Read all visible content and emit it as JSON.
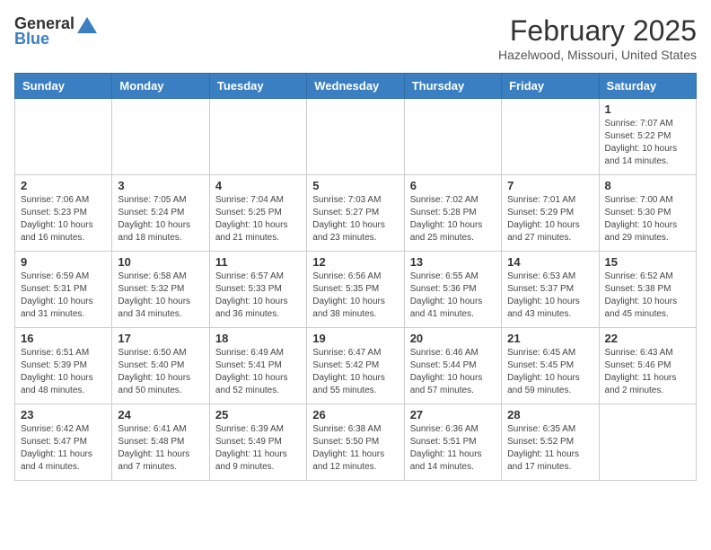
{
  "header": {
    "logo_general": "General",
    "logo_blue": "Blue",
    "month_title": "February 2025",
    "location": "Hazelwood, Missouri, United States"
  },
  "weekdays": [
    "Sunday",
    "Monday",
    "Tuesday",
    "Wednesday",
    "Thursday",
    "Friday",
    "Saturday"
  ],
  "weeks": [
    [
      {
        "day": "",
        "info": ""
      },
      {
        "day": "",
        "info": ""
      },
      {
        "day": "",
        "info": ""
      },
      {
        "day": "",
        "info": ""
      },
      {
        "day": "",
        "info": ""
      },
      {
        "day": "",
        "info": ""
      },
      {
        "day": "1",
        "info": "Sunrise: 7:07 AM\nSunset: 5:22 PM\nDaylight: 10 hours\nand 14 minutes."
      }
    ],
    [
      {
        "day": "2",
        "info": "Sunrise: 7:06 AM\nSunset: 5:23 PM\nDaylight: 10 hours\nand 16 minutes."
      },
      {
        "day": "3",
        "info": "Sunrise: 7:05 AM\nSunset: 5:24 PM\nDaylight: 10 hours\nand 18 minutes."
      },
      {
        "day": "4",
        "info": "Sunrise: 7:04 AM\nSunset: 5:25 PM\nDaylight: 10 hours\nand 21 minutes."
      },
      {
        "day": "5",
        "info": "Sunrise: 7:03 AM\nSunset: 5:27 PM\nDaylight: 10 hours\nand 23 minutes."
      },
      {
        "day": "6",
        "info": "Sunrise: 7:02 AM\nSunset: 5:28 PM\nDaylight: 10 hours\nand 25 minutes."
      },
      {
        "day": "7",
        "info": "Sunrise: 7:01 AM\nSunset: 5:29 PM\nDaylight: 10 hours\nand 27 minutes."
      },
      {
        "day": "8",
        "info": "Sunrise: 7:00 AM\nSunset: 5:30 PM\nDaylight: 10 hours\nand 29 minutes."
      }
    ],
    [
      {
        "day": "9",
        "info": "Sunrise: 6:59 AM\nSunset: 5:31 PM\nDaylight: 10 hours\nand 31 minutes."
      },
      {
        "day": "10",
        "info": "Sunrise: 6:58 AM\nSunset: 5:32 PM\nDaylight: 10 hours\nand 34 minutes."
      },
      {
        "day": "11",
        "info": "Sunrise: 6:57 AM\nSunset: 5:33 PM\nDaylight: 10 hours\nand 36 minutes."
      },
      {
        "day": "12",
        "info": "Sunrise: 6:56 AM\nSunset: 5:35 PM\nDaylight: 10 hours\nand 38 minutes."
      },
      {
        "day": "13",
        "info": "Sunrise: 6:55 AM\nSunset: 5:36 PM\nDaylight: 10 hours\nand 41 minutes."
      },
      {
        "day": "14",
        "info": "Sunrise: 6:53 AM\nSunset: 5:37 PM\nDaylight: 10 hours\nand 43 minutes."
      },
      {
        "day": "15",
        "info": "Sunrise: 6:52 AM\nSunset: 5:38 PM\nDaylight: 10 hours\nand 45 minutes."
      }
    ],
    [
      {
        "day": "16",
        "info": "Sunrise: 6:51 AM\nSunset: 5:39 PM\nDaylight: 10 hours\nand 48 minutes."
      },
      {
        "day": "17",
        "info": "Sunrise: 6:50 AM\nSunset: 5:40 PM\nDaylight: 10 hours\nand 50 minutes."
      },
      {
        "day": "18",
        "info": "Sunrise: 6:49 AM\nSunset: 5:41 PM\nDaylight: 10 hours\nand 52 minutes."
      },
      {
        "day": "19",
        "info": "Sunrise: 6:47 AM\nSunset: 5:42 PM\nDaylight: 10 hours\nand 55 minutes."
      },
      {
        "day": "20",
        "info": "Sunrise: 6:46 AM\nSunset: 5:44 PM\nDaylight: 10 hours\nand 57 minutes."
      },
      {
        "day": "21",
        "info": "Sunrise: 6:45 AM\nSunset: 5:45 PM\nDaylight: 10 hours\nand 59 minutes."
      },
      {
        "day": "22",
        "info": "Sunrise: 6:43 AM\nSunset: 5:46 PM\nDaylight: 11 hours\nand 2 minutes."
      }
    ],
    [
      {
        "day": "23",
        "info": "Sunrise: 6:42 AM\nSunset: 5:47 PM\nDaylight: 11 hours\nand 4 minutes."
      },
      {
        "day": "24",
        "info": "Sunrise: 6:41 AM\nSunset: 5:48 PM\nDaylight: 11 hours\nand 7 minutes."
      },
      {
        "day": "25",
        "info": "Sunrise: 6:39 AM\nSunset: 5:49 PM\nDaylight: 11 hours\nand 9 minutes."
      },
      {
        "day": "26",
        "info": "Sunrise: 6:38 AM\nSunset: 5:50 PM\nDaylight: 11 hours\nand 12 minutes."
      },
      {
        "day": "27",
        "info": "Sunrise: 6:36 AM\nSunset: 5:51 PM\nDaylight: 11 hours\nand 14 minutes."
      },
      {
        "day": "28",
        "info": "Sunrise: 6:35 AM\nSunset: 5:52 PM\nDaylight: 11 hours\nand 17 minutes."
      },
      {
        "day": "",
        "info": ""
      }
    ]
  ]
}
